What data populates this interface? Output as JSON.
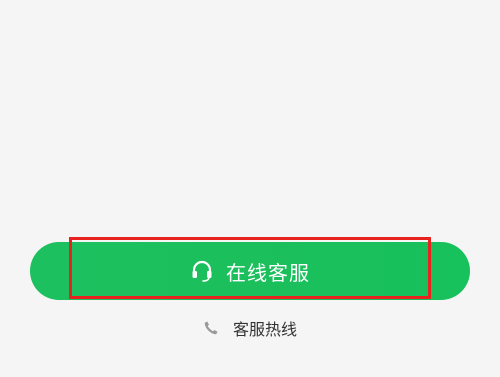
{
  "actions": {
    "online_service": {
      "label": "在线客服",
      "icon": "headset-icon"
    },
    "hotline": {
      "label": "客服热线",
      "icon": "phone-icon"
    }
  },
  "colors": {
    "background": "#f5f5f5",
    "primary_green": "#1bbf5c",
    "highlight_red": "#e8231f",
    "text_dark": "#333333",
    "icon_gray": "#999999"
  }
}
